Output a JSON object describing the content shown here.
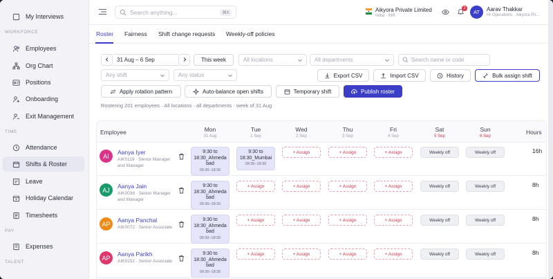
{
  "colors": {
    "accent": "#3b3fc7",
    "danger": "#d0344a"
  },
  "sidebar": {
    "top_item": "My Interviews",
    "sections": {
      "workforce": "WORKFORCE",
      "time": "TIME",
      "pay": "PAY",
      "talent": "TALENT"
    },
    "workforce_items": [
      {
        "label": "Employees",
        "icon": "users-icon"
      },
      {
        "label": "Org Chart",
        "icon": "org-chart-icon"
      },
      {
        "label": "Positions",
        "icon": "positions-icon"
      },
      {
        "label": "Onboarding",
        "icon": "onboarding-icon"
      },
      {
        "label": "Exit Management",
        "icon": "exit-icon"
      }
    ],
    "time_items": [
      {
        "label": "Attendance",
        "icon": "clock-icon"
      },
      {
        "label": "Shifts & Roster",
        "icon": "calendar-icon"
      },
      {
        "label": "Leave",
        "icon": "leave-icon"
      },
      {
        "label": "Holiday Calendar",
        "icon": "holiday-icon"
      },
      {
        "label": "Timesheets",
        "icon": "timesheet-icon"
      }
    ],
    "pay_items": [
      {
        "label": "Expenses",
        "icon": "expenses-icon"
      }
    ]
  },
  "topbar": {
    "search_placeholder": "Search anything...",
    "shortcut": "⌘K",
    "org_name": "Aikyora Private Limited",
    "org_sub": "India · INR",
    "notif_count": "2",
    "user_initials": "AT",
    "user_name": "Aarav Thakkar",
    "user_sub": "Hr Operations · Aikyora Pri..."
  },
  "tabs": [
    "Roster",
    "Fairness",
    "Shift change requests",
    "Weekly-off policies"
  ],
  "controls": {
    "date_range": "31 Aug – 6 Sep",
    "this_week": "This week",
    "all_locations": "All locations",
    "all_departments": "All departments",
    "search_employee": "Search name or code",
    "any_shift": "Any shift",
    "any_status": "Any status",
    "export_csv": "Export CSV",
    "import_csv": "Import CSV",
    "history": "History",
    "bulk_assign": "Bulk assign shift",
    "rotation": "Apply rotation pattern",
    "auto_balance": "Auto-balance open shifts",
    "temporary": "Temporary shift",
    "publish": "Publish roster"
  },
  "summary": "Rostering 201 employees · All locations · all departments · week of 31 Aug",
  "table": {
    "employee_header": "Employee",
    "hours_header": "Hours",
    "days": [
      {
        "day": "Mon",
        "date": "31 Aug"
      },
      {
        "day": "Tue",
        "date": "1 Sep"
      },
      {
        "day": "Wed",
        "date": "2 Sep"
      },
      {
        "day": "Thu",
        "date": "3 Sep"
      },
      {
        "day": "Fri",
        "date": "4 Sep"
      },
      {
        "day": "Sat",
        "date": "5 Sep"
      },
      {
        "day": "Sun",
        "date": "6 Sep"
      }
    ],
    "assign_label": "+ Assign",
    "weekly_off_label": "Weekly off",
    "rows": [
      {
        "initials": "AI",
        "avatar_color": "#d9338a",
        "name": "Aanya Iyer",
        "sub": "AIK0119 · Senior Manager and Manager",
        "hours": "16h",
        "cells": [
          {
            "type": "shift",
            "line1": "9:30 to",
            "line2": "18:30_Ahmeda",
            "line3": "bad",
            "time": "09:30–18:30"
          },
          {
            "type": "shift",
            "line1": "9:30 to",
            "line2": "18:30_Mumbai",
            "line3": "",
            "time": "09:30–18:30"
          },
          {
            "type": "assign"
          },
          {
            "type": "assign"
          },
          {
            "type": "assign"
          },
          {
            "type": "off"
          },
          {
            "type": "off"
          }
        ]
      },
      {
        "initials": "AJ",
        "avatar_color": "#1a9a6c",
        "name": "Aanya Jain",
        "sub": "AIK0038 · Senior Manager and Manager",
        "hours": "8h",
        "cells": [
          {
            "type": "shift",
            "line1": "9:30 to",
            "line2": "18:30_Ahmeda",
            "line3": "bad",
            "time": "09:30–18:30"
          },
          {
            "type": "assign"
          },
          {
            "type": "assign"
          },
          {
            "type": "assign"
          },
          {
            "type": "assign"
          },
          {
            "type": "off"
          },
          {
            "type": "off"
          }
        ]
      },
      {
        "initials": "AP",
        "avatar_color": "#ef8a17",
        "name": "Aanya Panchal",
        "sub": "AIK0072 · Senior Associate",
        "hours": "8h",
        "cells": [
          {
            "type": "shift",
            "line1": "9:30 to",
            "line2": "18:30_Ahmeda",
            "line3": "bad",
            "time": "09:30–18:30"
          },
          {
            "type": "assign"
          },
          {
            "type": "assign"
          },
          {
            "type": "assign"
          },
          {
            "type": "assign"
          },
          {
            "type": "off"
          },
          {
            "type": "off"
          }
        ]
      },
      {
        "initials": "AP",
        "avatar_color": "#e0366c",
        "name": "Aanya Parikh",
        "sub": "AIK0152 · Senior Associate",
        "hours": "8h",
        "cells": [
          {
            "type": "shift",
            "line1": "9:30 to",
            "line2": "18:30_Ahmeda",
            "line3": "bad",
            "time": "09:30–18:30"
          },
          {
            "type": "assign"
          },
          {
            "type": "assign"
          },
          {
            "type": "assign"
          },
          {
            "type": "assign"
          },
          {
            "type": "off"
          },
          {
            "type": "off"
          }
        ]
      }
    ]
  }
}
